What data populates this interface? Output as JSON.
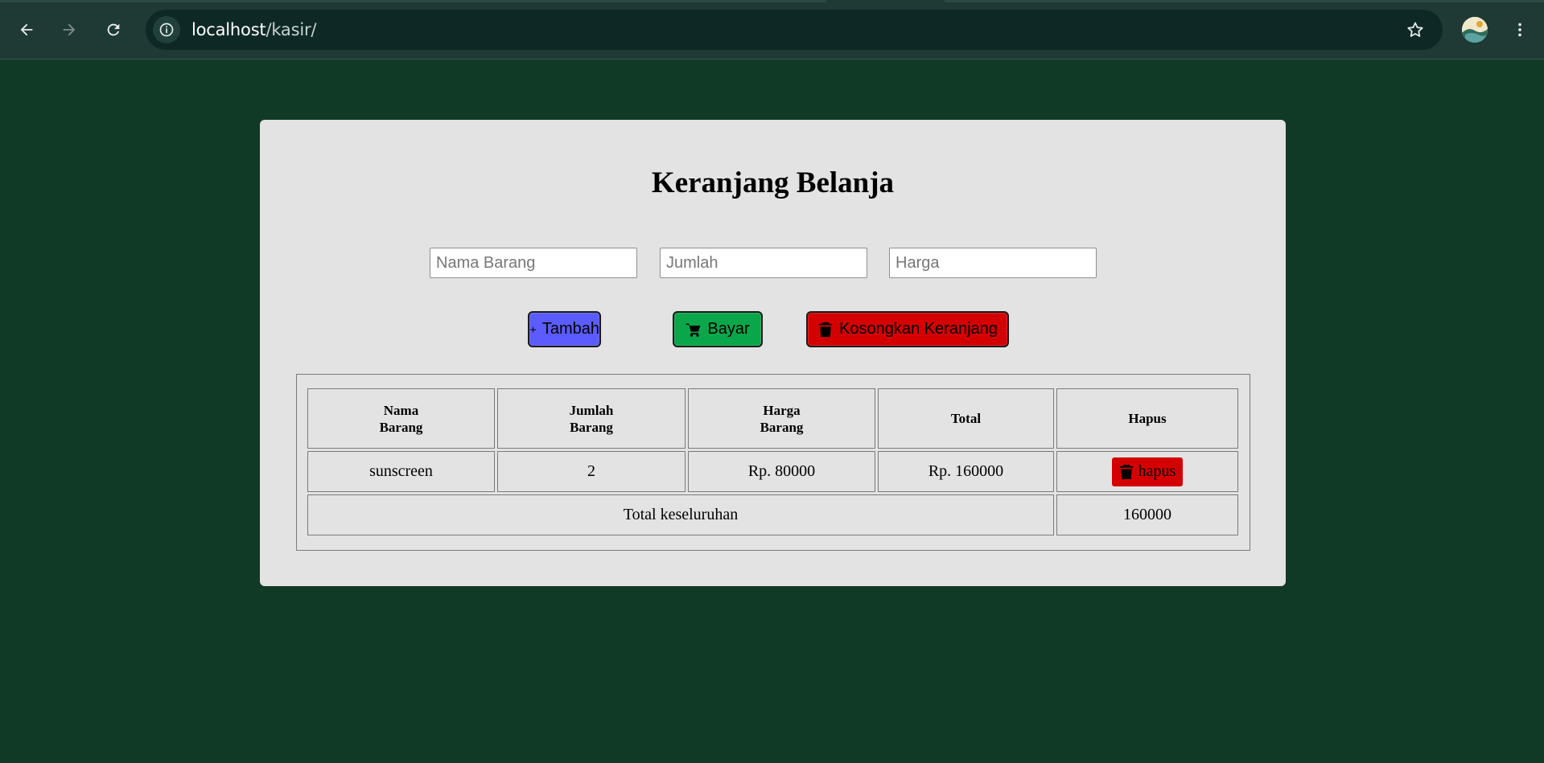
{
  "browser": {
    "url_host": "localhost",
    "url_path": "/kasir/"
  },
  "page": {
    "title": "Keranjang Belanja",
    "inputs": {
      "nama_placeholder": "Nama Barang",
      "jumlah_placeholder": "Jumlah",
      "harga_placeholder": "Harga"
    },
    "buttons": {
      "tambah": "Tambah",
      "bayar": "Bayar",
      "kosongkan": "Kosongkan Keranjang"
    },
    "table": {
      "headers": [
        "Nama\nBarang",
        "Jumlah\nBarang",
        "Harga\nBarang",
        "Total",
        "Hapus"
      ],
      "rows": [
        {
          "nama": "sunscreen",
          "jumlah": "2",
          "harga": "Rp. 80000",
          "total": "Rp. 160000",
          "hapus": "hapus"
        }
      ],
      "footer_label": "Total keseluruhan",
      "footer_total": "160000"
    }
  },
  "colors": {
    "background": "#103a25",
    "card": "#e3e3e3",
    "tambah": "#5a5cff",
    "bayar": "#09a74a",
    "kosongkan": "#d40000",
    "hapus": "#d40000"
  },
  "icons": {
    "tambah": "plus-icon",
    "bayar": "cart-icon",
    "kosongkan": "trash-icon",
    "hapus": "trash-icon"
  }
}
